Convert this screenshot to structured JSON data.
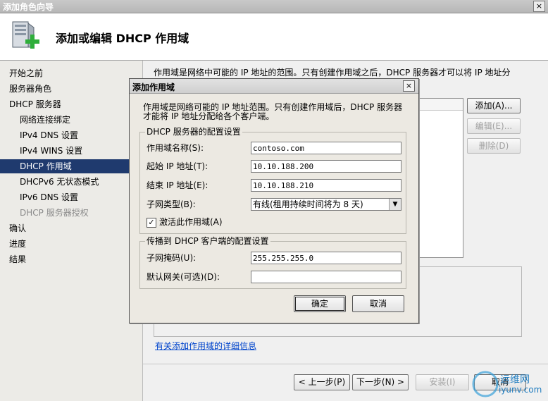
{
  "window": {
    "title": "添加角色向导",
    "close": "×"
  },
  "header": {
    "title": "添加或编辑 DHCP 作用域",
    "icon": "server-add-icon"
  },
  "sidebar": {
    "items": [
      {
        "label": "开始之前",
        "level": "top",
        "state": "normal"
      },
      {
        "label": "服务器角色",
        "level": "top",
        "state": "normal"
      },
      {
        "label": "DHCP 服务器",
        "level": "top",
        "state": "normal"
      },
      {
        "label": "网络连接绑定",
        "level": "sub",
        "state": "normal"
      },
      {
        "label": "IPv4 DNS 设置",
        "level": "sub",
        "state": "normal"
      },
      {
        "label": "IPv4 WINS 设置",
        "level": "sub",
        "state": "normal"
      },
      {
        "label": "DHCP 作用域",
        "level": "sub",
        "state": "selected"
      },
      {
        "label": "DHCPv6 无状态模式",
        "level": "sub",
        "state": "normal"
      },
      {
        "label": "IPv6 DNS 设置",
        "level": "sub",
        "state": "normal"
      },
      {
        "label": "DHCP 服务器授权",
        "level": "sub",
        "state": "disabled"
      },
      {
        "label": "确认",
        "level": "top",
        "state": "normal"
      },
      {
        "label": "进度",
        "level": "top",
        "state": "normal"
      },
      {
        "label": "结果",
        "level": "top",
        "state": "normal"
      }
    ]
  },
  "main": {
    "description": "作用域是网络中可能的 IP 地址的范围。只有创建作用域之后，DHCP 服务器才可以将 IP 地址分",
    "buttons": {
      "add": "添加(A)...",
      "edit": "编辑(E)...",
      "delete": "删除(D)"
    },
    "link": "有关添加作用域的详细信息"
  },
  "footer": {
    "prev": "< 上一步(P)",
    "next": "下一步(N) >",
    "install": "安装(I)",
    "cancel": "取消"
  },
  "dialog": {
    "title": "添加作用域",
    "close": "×",
    "description": "作用域是网络可能的 IP 地址范围。只有创建作用域后，DHCP 服务器才能将 IP 地址分配给各个客户端。",
    "server_group": {
      "label": "DHCP 服务器的配置设置",
      "scope_name_label": "作用域名称(S):",
      "scope_name_value": "contoso.com",
      "start_ip_label": "起始 IP 地址(T):",
      "start_ip_value": "10.10.188.200",
      "end_ip_label": "结束 IP 地址(E):",
      "end_ip_value": "10.10.188.210",
      "subnet_type_label": "子网类型(B):",
      "subnet_type_value": "有线(租用持续时间将为 8 天)",
      "activate_label": "激活此作用域(A)",
      "activate_checked": "✓"
    },
    "client_group": {
      "label": "传播到 DHCP 客户端的配置设置",
      "mask_label": "子网掩码(U):",
      "mask_value": "255.255.255.0",
      "gateway_label": "默认网关(可选)(D):",
      "gateway_value": ""
    },
    "ok": "确定",
    "cancel": "取消"
  },
  "watermark": {
    "text1": "运维网",
    "text2": "iyunv.com"
  },
  "colors": {
    "selected": "#1f3a6e",
    "link": "#0044cc",
    "dialog_bg": "#ece9e2"
  }
}
